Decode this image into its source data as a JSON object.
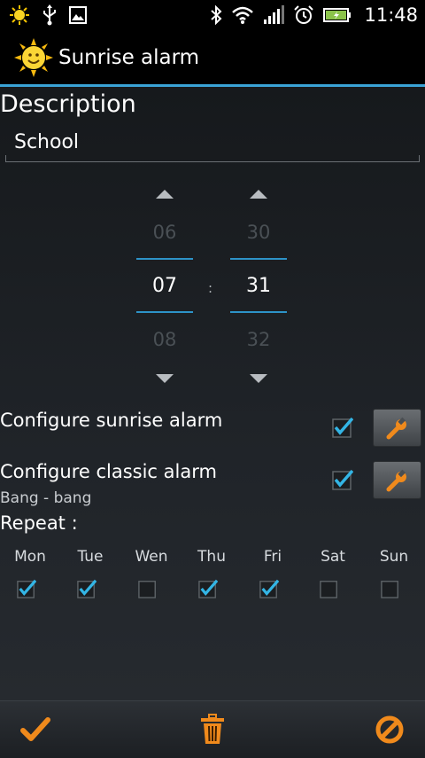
{
  "status_bar": {
    "time": "11:48",
    "left_icons": [
      "sun-notification-icon",
      "usb-icon",
      "image-icon"
    ],
    "right_icons": [
      "bluetooth-icon",
      "wifi-icon",
      "signal-icon",
      "alarm-clock-icon",
      "battery-icon"
    ]
  },
  "app": {
    "title": "Sunrise alarm",
    "icon": "sun-icon"
  },
  "description": {
    "label": "Description",
    "value": "School"
  },
  "time_picker": {
    "hours": {
      "previous": "06",
      "current": "07",
      "next": "08"
    },
    "minutes": {
      "previous": "30",
      "current": "31",
      "next": "32"
    },
    "separator": ":"
  },
  "options": {
    "sunrise": {
      "label": "Configure sunrise alarm",
      "checked": true
    },
    "classic": {
      "label": "Configure classic alarm",
      "sublabel": "Bang - bang",
      "checked": true
    }
  },
  "repeat": {
    "label": "Repeat :",
    "days": [
      {
        "label": "Mon",
        "checked": true
      },
      {
        "label": "Tue",
        "checked": true
      },
      {
        "label": "Wen",
        "checked": false
      },
      {
        "label": "Thu",
        "checked": true
      },
      {
        "label": "Fri",
        "checked": true
      },
      {
        "label": "Sat",
        "checked": false
      },
      {
        "label": "Sun",
        "checked": false
      }
    ]
  },
  "bottom_bar": {
    "buttons": [
      "confirm-check-icon",
      "delete-trash-icon",
      "cancel-icon"
    ]
  },
  "colors": {
    "accent": "#3aa3d6",
    "checkmark": "#33b5e5",
    "orange": "#f08a1c"
  }
}
